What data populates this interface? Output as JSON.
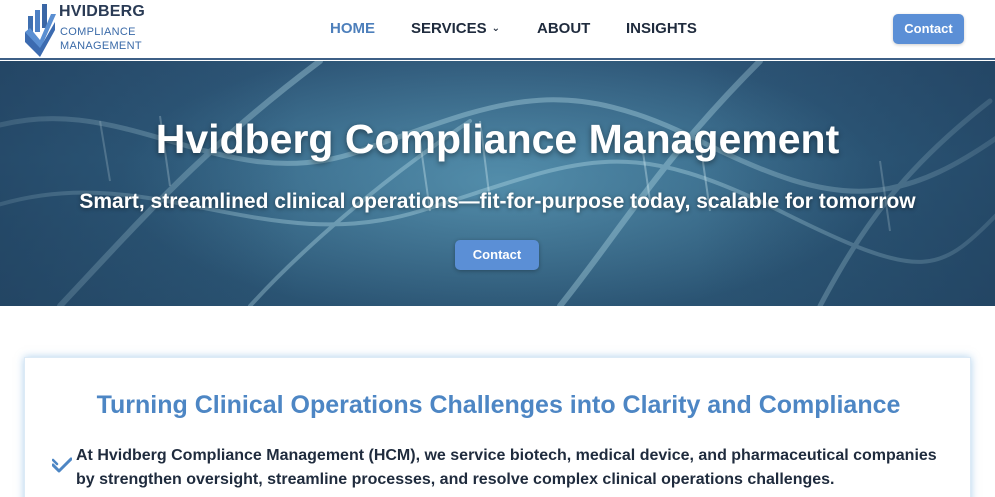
{
  "logo": {
    "title": "HVIDBERG",
    "subtitle": "COMPLIANCE MANAGEMENT",
    "icon": "shield-check-logo-icon"
  },
  "nav": {
    "items": [
      {
        "label": "HOME",
        "active": true
      },
      {
        "label": "SERVICES",
        "has_dropdown": true,
        "chevron": "⌄"
      },
      {
        "label": "ABOUT"
      },
      {
        "label": "INSIGHTS"
      }
    ],
    "contact_label": "Contact"
  },
  "hero": {
    "title": "Hvidberg Compliance Management",
    "subtitle": "Smart, streamlined clinical operations—fit-for-purpose today, scalable for tomorrow",
    "button_label": "Contact",
    "background": "dna-helix-image"
  },
  "intro": {
    "heading": "Turning Clinical Operations Challenges into Clarity and Compliance",
    "icon": "double-check-icon",
    "text": "At Hvidberg Compliance Management (HCM), we service biotech, medical device, and pharmaceutical companies by strengthen oversight, streamline processes, and resolve complex clinical operations challenges."
  },
  "colors": {
    "accent": "#5b8fd6",
    "nav_active": "#4d7fbb",
    "nav_text": "#1f2b3d",
    "heading_blue": "#4d86c4",
    "hero_bg": "#2d5576",
    "header_border": "#3d5f86"
  }
}
